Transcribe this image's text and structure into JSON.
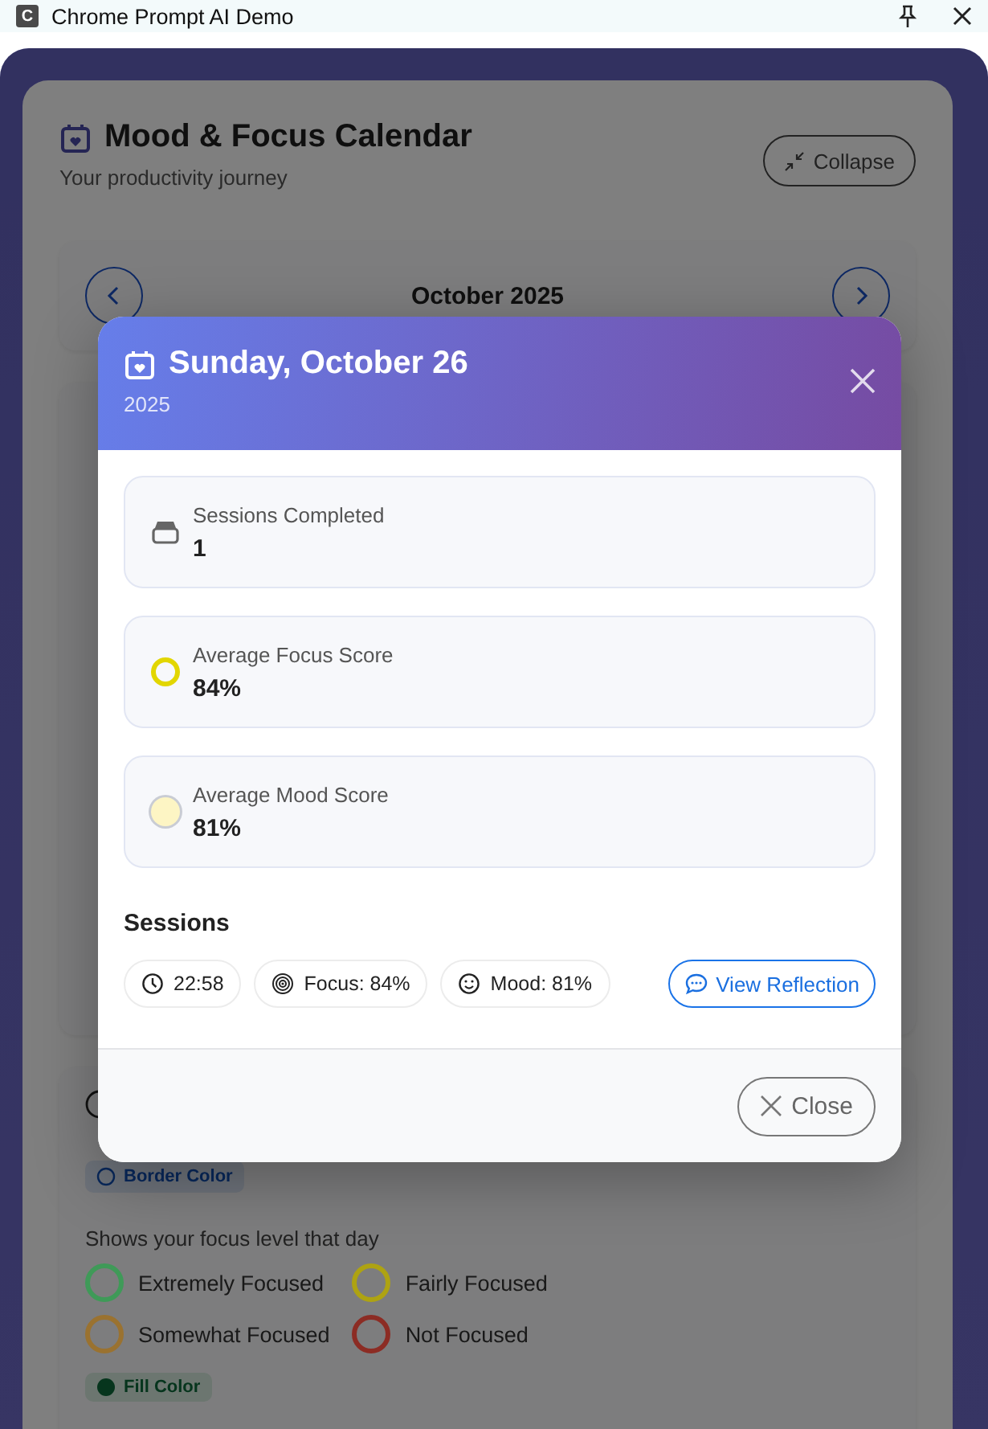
{
  "window": {
    "title": "Chrome Prompt AI Demo",
    "app_letter": "C"
  },
  "header": {
    "title": "Mood & Focus Calendar",
    "subtitle": "Your productivity journey",
    "collapse_button": "Collapse"
  },
  "month_nav": {
    "month": "October 2025"
  },
  "legend": {
    "border_badge": "Border Color",
    "description": "Shows your focus level that day",
    "fill_badge": "Fill Color",
    "items": [
      {
        "label": "Extremely Focused",
        "color": "#3f9a58"
      },
      {
        "label": "Fairly Focused",
        "color": "#aea312"
      },
      {
        "label": "Somewhat Focused",
        "color": "#9a7230"
      },
      {
        "label": "Not Focused",
        "color": "#8c2c24"
      }
    ]
  },
  "modal": {
    "title": "Sunday, October 26",
    "year": "2025",
    "stats": [
      {
        "kind": "sessions",
        "label": "Sessions Completed",
        "value": "1"
      },
      {
        "kind": "ring",
        "label": "Average Focus Score",
        "value": "84%",
        "color": "#e2d600"
      },
      {
        "kind": "dot",
        "label": "Average Mood Score",
        "value": "81%",
        "color": "#fdf5c4"
      }
    ],
    "sessions_heading": "Sessions",
    "sessions": [
      {
        "kind": "time",
        "text": "22:58"
      },
      {
        "kind": "focus",
        "text": "Focus: 84%"
      },
      {
        "kind": "mood",
        "text": "Mood: 81%"
      }
    ],
    "reflection_button": "View Reflection",
    "close_button": "Close"
  }
}
